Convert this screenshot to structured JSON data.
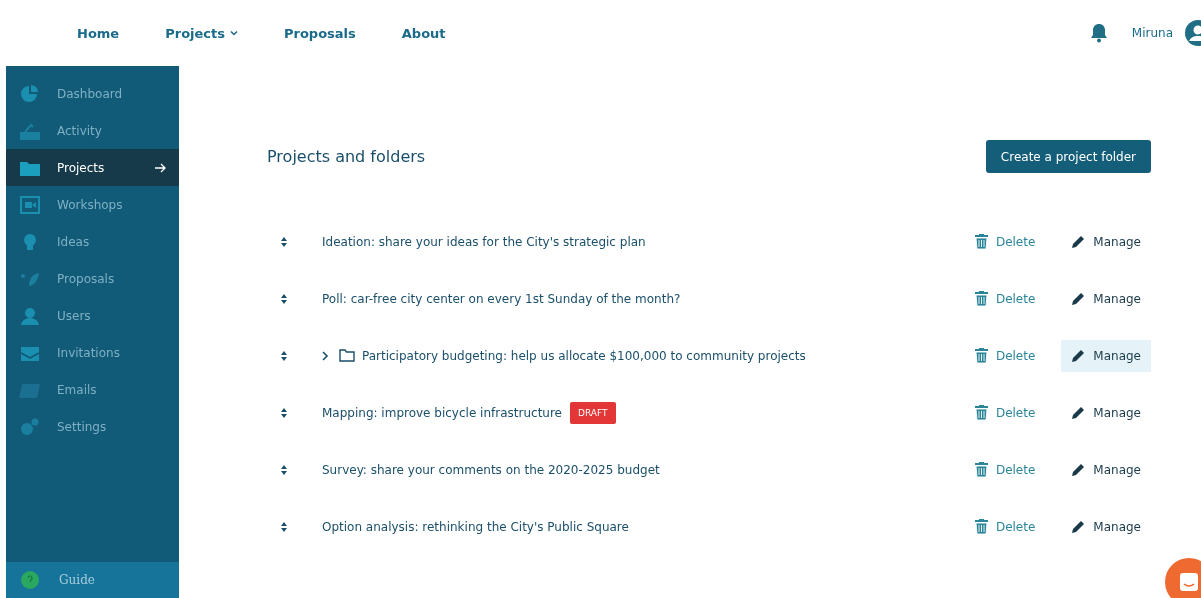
{
  "nav": {
    "links": [
      {
        "label": "Home",
        "dropdown": false
      },
      {
        "label": "Projects",
        "dropdown": true
      },
      {
        "label": "Proposals",
        "dropdown": false
      },
      {
        "label": "About",
        "dropdown": false
      }
    ],
    "user": "Miruna"
  },
  "sidebar": {
    "items": [
      {
        "label": "Dashboard",
        "selected": false
      },
      {
        "label": "Activity",
        "selected": false
      },
      {
        "label": "Projects",
        "selected": true
      },
      {
        "label": "Workshops",
        "selected": false
      },
      {
        "label": "Ideas",
        "selected": false
      },
      {
        "label": "Proposals",
        "selected": false
      },
      {
        "label": "Users",
        "selected": false
      },
      {
        "label": "Invitations",
        "selected": false
      },
      {
        "label": "Emails",
        "selected": false
      },
      {
        "label": "Settings",
        "selected": false
      }
    ],
    "guide": "Guide"
  },
  "main": {
    "title": "Projects and folders",
    "create_button": "Create a project folder",
    "rows": [
      {
        "kind": "project",
        "title": "Ideation: share your ideas for the City's strategic plan",
        "delete": "Delete",
        "manage": "Manage",
        "hovered": false
      },
      {
        "kind": "project",
        "title": "Poll: car-free city center on every 1st Sunday of the month?",
        "delete": "Delete",
        "manage": "Manage",
        "hovered": false
      },
      {
        "kind": "folder",
        "title": "Participatory budgeting: help us allocate $100,000 to community projects",
        "delete": "Delete",
        "manage": "Manage",
        "hovered": true
      },
      {
        "kind": "project",
        "title": "Mapping: improve bicycle infrastructure",
        "badge": "DRAFT",
        "delete": "Delete",
        "manage": "Manage",
        "hovered": false
      },
      {
        "kind": "project",
        "title": "Survey: share your comments on the 2020-2025 budget",
        "delete": "Delete",
        "manage": "Manage",
        "hovered": false
      },
      {
        "kind": "project",
        "title": "Option analysis: rethinking the City's Public Square",
        "delete": "Delete",
        "manage": "Manage",
        "hovered": false
      }
    ]
  }
}
